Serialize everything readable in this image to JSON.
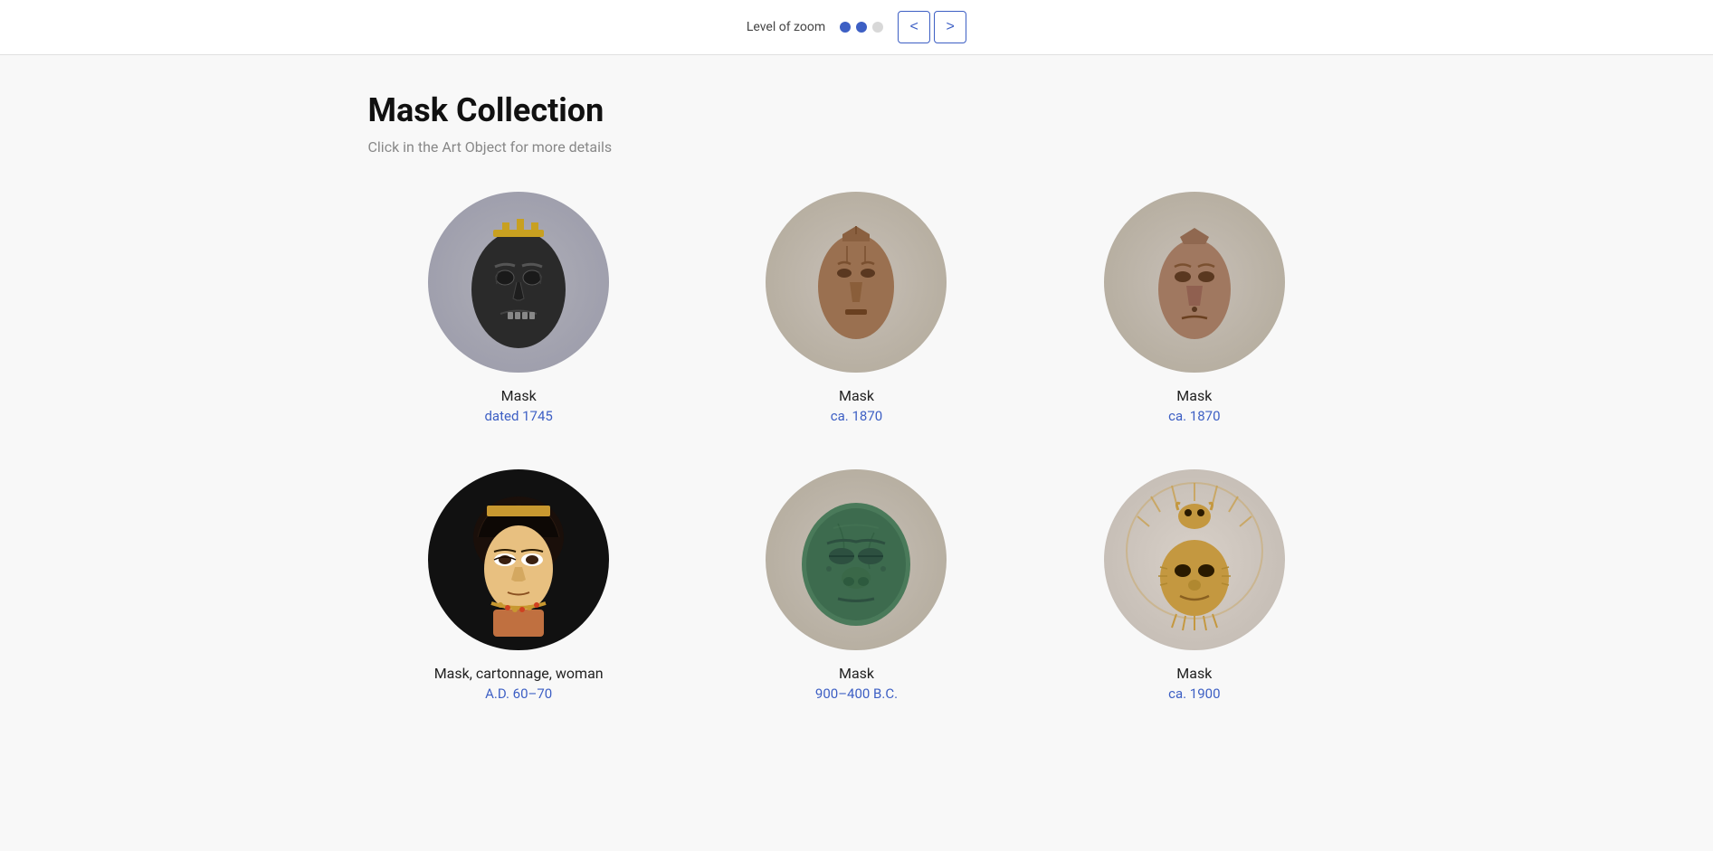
{
  "header": {
    "zoom_label": "Level of zoom",
    "prev_label": "<",
    "next_label": ">",
    "dots": [
      {
        "state": "active"
      },
      {
        "state": "active"
      },
      {
        "state": "empty"
      }
    ]
  },
  "page": {
    "title": "Mask Collection",
    "subtitle": "Click in the Art Object for more details"
  },
  "masks": [
    {
      "id": 1,
      "name": "Mask",
      "date": "dated 1745",
      "bg": "light-gray",
      "face_color": "#3a3a3a"
    },
    {
      "id": 2,
      "name": "Mask",
      "date": "ca. 1870",
      "bg": "light-gray",
      "face_color": "#a0785a"
    },
    {
      "id": 3,
      "name": "Mask",
      "date": "ca. 1870",
      "bg": "light-gray",
      "face_color": "#a0785a"
    },
    {
      "id": 4,
      "name": "Mask, cartonnage, woman",
      "date": "A.D. 60–70",
      "bg": "dark",
      "face_color": "#d4a060"
    },
    {
      "id": 5,
      "name": "Mask",
      "date": "900–400 B.C.",
      "bg": "light-gray",
      "face_color": "#4a7a5a"
    },
    {
      "id": 6,
      "name": "Mask",
      "date": "ca. 1900",
      "bg": "light-gray",
      "face_color": "#c8a060"
    }
  ]
}
